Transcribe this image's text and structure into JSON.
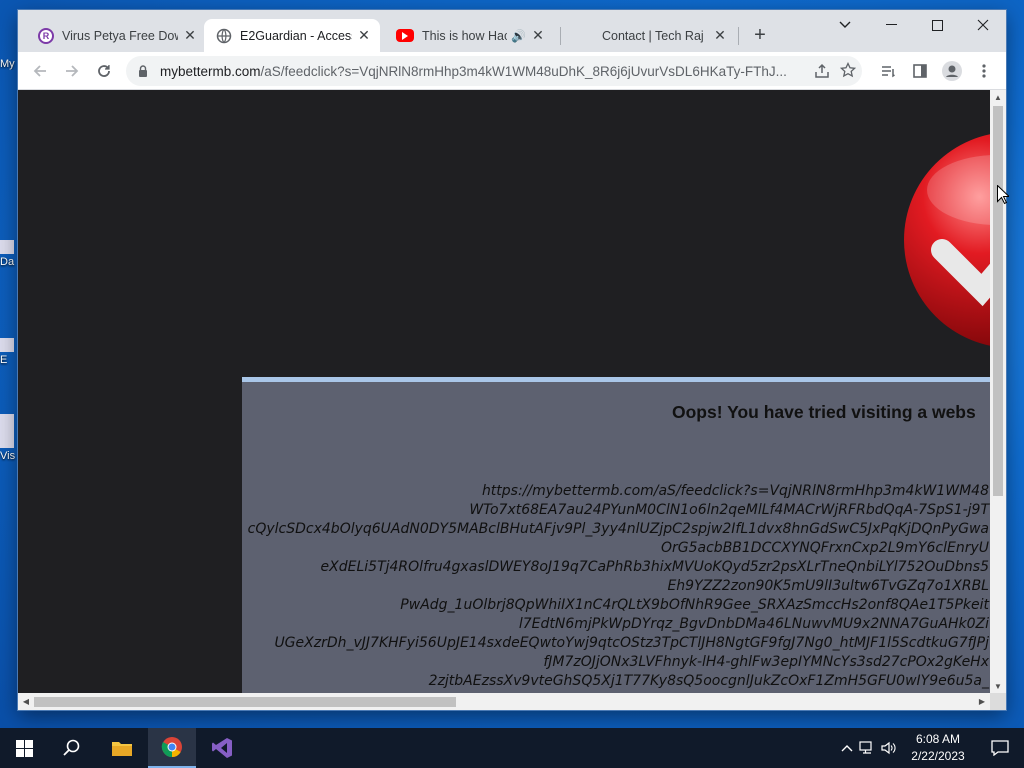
{
  "desktop": {
    "icon_labels": [
      "My",
      "Da",
      "E",
      "Vis"
    ]
  },
  "browser": {
    "tabs": [
      {
        "title": "Virus Petya Free Dow",
        "icon": "site-favicon-icon"
      },
      {
        "title": "E2Guardian - Access",
        "icon": "globe-icon",
        "active": true
      },
      {
        "title": "This is how Hack",
        "icon": "youtube-icon",
        "audio_icon": "speaker-icon"
      },
      {
        "title": "Contact | Tech Raj",
        "icon": "blank-favicon-icon"
      }
    ],
    "new_tab_label": "+",
    "url_host": "mybettermb.com",
    "url_path": "/aS/feedclick?s=VqjNRlN8rmHhp3m4kW1WM48uDhK_8R6j6jUvurVsDL6HKaTy-FThJ..."
  },
  "page": {
    "heading": "Oops! You have tried visiting a webs",
    "url_lines": [
      "https://mybettermb.com/aS/feedclick?s=VqjNRlN8rmHhp3m4kW1WM48",
      "WTo7xt68EA7au24PYunM0ClN1o6ln2qeMlLf4MACrWjRFRbdQqA-7SpS1-j9T",
      "cQylcSDcx4bOlyq6UAdN0DY5MABclBHutAFjv9Pl_3yy4nlUZjpC2spjw2IfL1dvx8hnGdSwC5JxPqKjDQnPyGwa",
      "OrG5acbBB1DCCXYNQFrxnCxp2L9mY6clEnryU",
      "eXdELi5Tj4ROlfru4gxaslDWEY8oJ19q7CaPhRb3hixMVUoKQyd5zr2psXLrTneQnbiLYl752OuDbns5",
      "Eh9YZZ2zon90K5mU9lI3ultw6TvGZq7o1XRBL",
      "PwAdg_1uOlbrj8QpWhiIX1nC4rQLtX9bOfNhR9Gee_SRXAzSmccHs2onf8QAe1T5Pkeit",
      "l7EdtN6mjPkWpDYrqz_BgvDnbDMa46LNuwvMU9x2NNA7GuAHk0Zi",
      "UGeXzrDh_vJJ7KHFyi56UpJE14sxdeEQwtoYwj9qtcOStz3TpCTlJH8NgtGF9fgJ7Ng0_htMJF1l5ScdtkuG7fJPj",
      "fJM7zOJjONx3LVFhnyk-lH4-ghlFw3epIYMNcYs3sd27cPOx2gKeHx",
      "2zjtbAEzssXv9vteGhSQ5Xj1T77Ky8sQ5oocgnlJukZcOxF1ZmH5GFU0wIY9e6u5a_"
    ]
  },
  "taskbar": {
    "items": [
      "start-icon",
      "search-icon",
      "file-explorer-icon",
      "chrome-icon",
      "visual-studio-icon"
    ],
    "time": "6:08 AM",
    "date": "2/22/2023"
  },
  "colors": {
    "page_bg": "#1f1f22",
    "panel_bg": "#5d6170",
    "panel_border": "#a9c6e8",
    "ball_red": "#d8161b"
  }
}
